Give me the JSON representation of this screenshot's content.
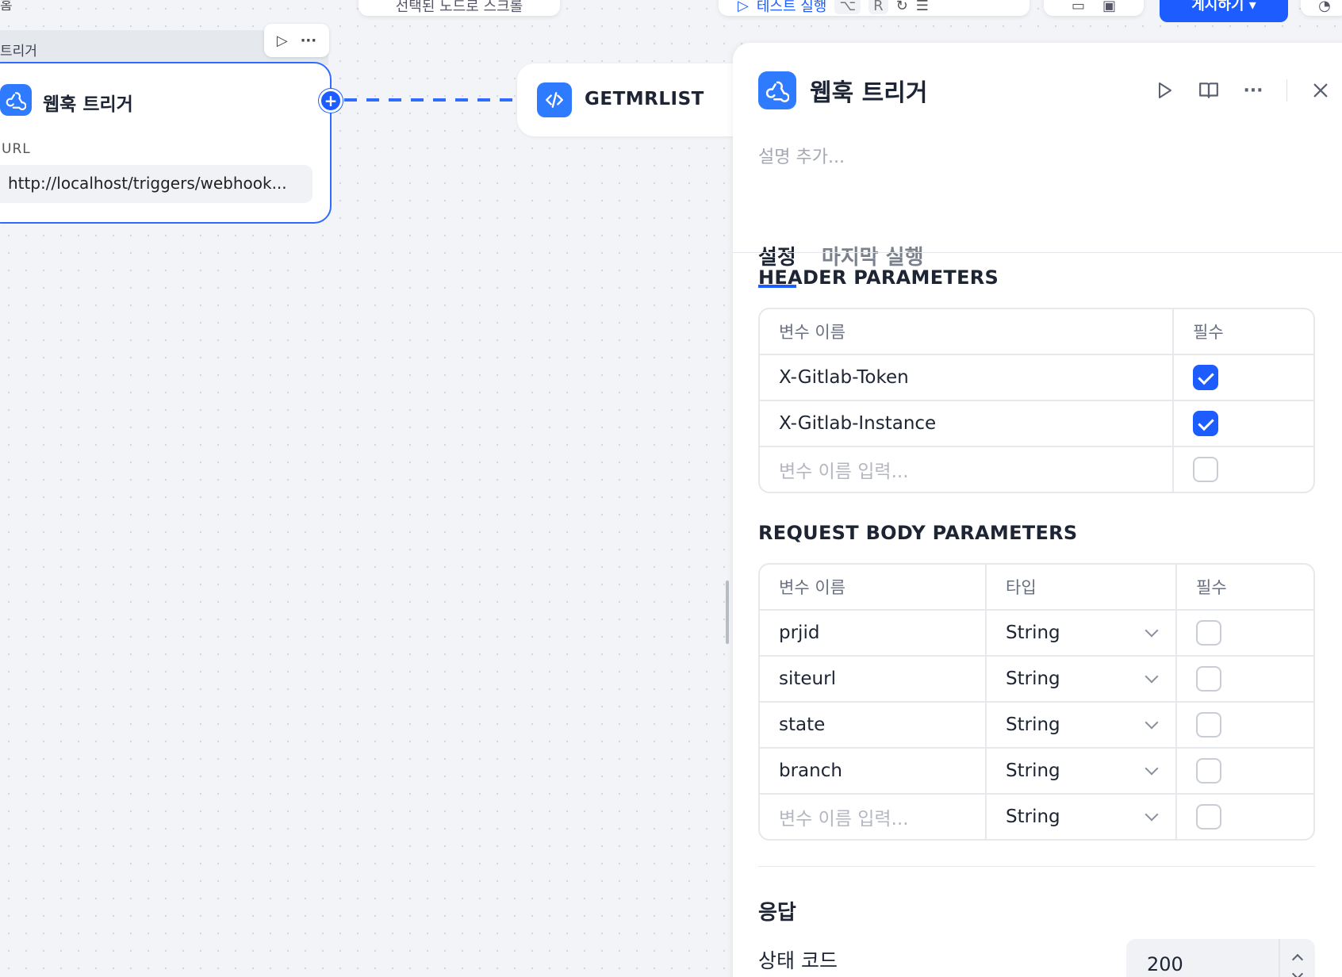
{
  "toolbar": {
    "corner_text": "홈",
    "center_pill_text": "선택된 노드로 스크롤",
    "test_run_label": "테스트 실행",
    "shortcut_alt": "⌥",
    "shortcut_key": "R",
    "publish_label": "게시하기 ▾"
  },
  "canvas": {
    "webhook_node": {
      "header_label": "트리거",
      "title": "웹훅 트리거",
      "url_label": "URL",
      "url_value": "http://localhost/triggers/webhook..."
    },
    "code_node": {
      "title": "GETMRLIST"
    }
  },
  "panel": {
    "title": "웹훅 트리거",
    "description_placeholder": "설명 추가...",
    "tabs": [
      "설정",
      "마지막 실행"
    ],
    "header_params": {
      "title": "HEADER PARAMETERS",
      "columns": [
        "변수 이름",
        "필수"
      ],
      "rows": [
        {
          "name": "X-Gitlab-Token",
          "required": true
        },
        {
          "name": "X-Gitlab-Instance",
          "required": true
        }
      ],
      "new_placeholder": "변수 이름 입력..."
    },
    "body_params": {
      "title": "REQUEST BODY PARAMETERS",
      "columns": [
        "변수 이름",
        "타입",
        "필수"
      ],
      "rows": [
        {
          "name": "prjid",
          "type": "String",
          "required": false
        },
        {
          "name": "siteurl",
          "type": "String",
          "required": false
        },
        {
          "name": "state",
          "type": "String",
          "required": false
        },
        {
          "name": "branch",
          "type": "String",
          "required": false
        }
      ],
      "new_placeholder": "변수 이름 입력...",
      "new_type": "String"
    },
    "response": {
      "title": "응답",
      "status_label": "상태 코드",
      "status_value": "200"
    }
  },
  "colors": {
    "accent": "#1d5cff",
    "icon_bg": "#2f7bff"
  },
  "icons": [
    "webhook-icon",
    "code-icon",
    "play-icon",
    "book-icon",
    "more-icon",
    "close-icon",
    "plus-icon",
    "chevron-down-icon"
  ]
}
